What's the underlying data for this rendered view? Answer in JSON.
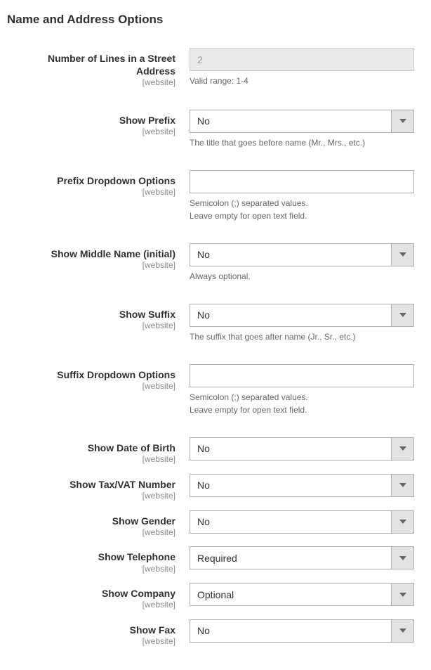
{
  "section_title": "Name and Address Options",
  "scope_label": "[website]",
  "fields": {
    "street_lines": {
      "label": "Number of Lines in a Street Address",
      "value": "2",
      "hint": "Valid range: 1-4"
    },
    "show_prefix": {
      "label": "Show Prefix",
      "value": "No",
      "hint": "The title that goes before name (Mr., Mrs., etc.)"
    },
    "prefix_options": {
      "label": "Prefix Dropdown Options",
      "value": "",
      "hint": "Semicolon (;) separated values.\nLeave empty for open text field."
    },
    "show_middle": {
      "label": "Show Middle Name (initial)",
      "value": "No",
      "hint": "Always optional."
    },
    "show_suffix": {
      "label": "Show Suffix",
      "value": "No",
      "hint": "The suffix that goes after name (Jr., Sr., etc.)"
    },
    "suffix_options": {
      "label": "Suffix Dropdown Options",
      "value": "",
      "hint": "Semicolon (;) separated values.\nLeave empty for open text field."
    },
    "show_dob": {
      "label": "Show Date of Birth",
      "value": "No"
    },
    "show_tax": {
      "label": "Show Tax/VAT Number",
      "value": "No"
    },
    "show_gender": {
      "label": "Show Gender",
      "value": "No"
    },
    "show_telephone": {
      "label": "Show Telephone",
      "value": "Required"
    },
    "show_company": {
      "label": "Show Company",
      "value": "Optional"
    },
    "show_fax": {
      "label": "Show Fax",
      "value": "No"
    }
  }
}
